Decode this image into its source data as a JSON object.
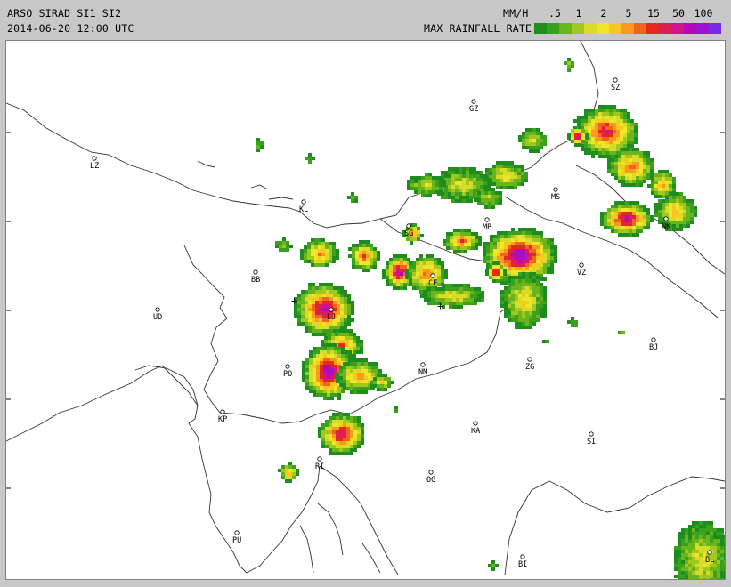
{
  "header": {
    "product": "ARSO SIRAD SI1 SI2",
    "datetime": "2014-06-20 12:00 UTC",
    "unit": "MM/H",
    "scale_title": "MAX RAINFALL RATE"
  },
  "legend": {
    "ticks": [
      ".5",
      "1",
      "2",
      "5",
      "15",
      "50",
      "100"
    ],
    "colors": [
      "#1e8c1e",
      "#3aa01e",
      "#6ab41e",
      "#a0c81e",
      "#d8dc28",
      "#f0e628",
      "#f8c81e",
      "#f89a1e",
      "#f0641e",
      "#e6281e",
      "#dc1e50",
      "#d2148c",
      "#b40ab4",
      "#9614d2",
      "#7828e6"
    ]
  },
  "cities": [
    {
      "code": "SZ"
    },
    {
      "code": "GZ"
    },
    {
      "code": "LZ"
    },
    {
      "code": "KL"
    },
    {
      "code": "MS"
    },
    {
      "code": "SG"
    },
    {
      "code": "MB"
    },
    {
      "code": "BB"
    },
    {
      "code": "CE"
    },
    {
      "code": "VZ"
    },
    {
      "code": "UD"
    },
    {
      "code": "LJ"
    },
    {
      "code": "BJ"
    },
    {
      "code": "ZG"
    },
    {
      "code": "PO"
    },
    {
      "code": "NM"
    },
    {
      "code": "KP"
    },
    {
      "code": "KA"
    },
    {
      "code": "SI"
    },
    {
      "code": "RI"
    },
    {
      "code": "OG"
    },
    {
      "code": "PU"
    },
    {
      "code": "BI"
    },
    {
      "code": "BL"
    },
    {
      "code": "NK"
    }
  ],
  "markers": [
    {
      "symbol": "+"
    },
    {
      "symbol": "+"
    }
  ]
}
